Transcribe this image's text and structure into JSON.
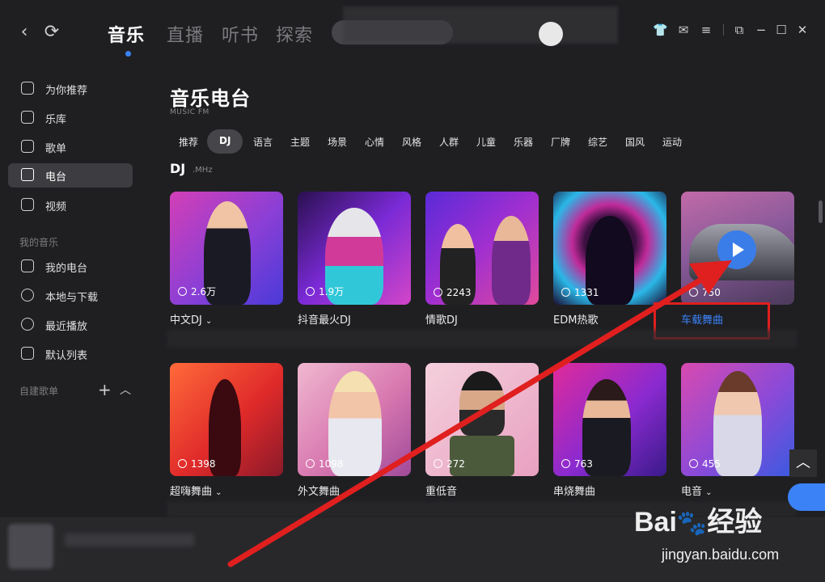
{
  "top": {
    "tabs": [
      "音乐",
      "直播",
      "听书",
      "探索"
    ],
    "active_tab": "音乐"
  },
  "sidebar": {
    "items": [
      {
        "label": "为你推荐",
        "icon": "star-icon"
      },
      {
        "label": "乐库",
        "icon": "music-note-icon"
      },
      {
        "label": "歌单",
        "icon": "playlist-icon"
      },
      {
        "label": "电台",
        "icon": "radio-icon",
        "active": true
      },
      {
        "label": "视频",
        "icon": "video-icon"
      }
    ],
    "my_music_title": "我的音乐",
    "my_items": [
      {
        "label": "我的电台",
        "icon": "radio-icon"
      },
      {
        "label": "本地与下载",
        "icon": "download-icon"
      },
      {
        "label": "最近播放",
        "icon": "clock-icon"
      },
      {
        "label": "默认列表",
        "icon": "list-icon"
      }
    ],
    "custom_title": "自建歌单"
  },
  "page": {
    "title": "音乐电台",
    "subtitle": "MUSIC FM",
    "categories": [
      "推荐",
      "DJ",
      "语言",
      "主题",
      "场景",
      "心情",
      "风格",
      "人群",
      "儿童",
      "乐器",
      "厂牌",
      "综艺",
      "国风",
      "运动"
    ],
    "active_category": "DJ",
    "section_title": "DJ",
    "section_sub": ".MHz"
  },
  "cards": [
    {
      "title": "中文DJ",
      "count": "2.6万",
      "dropdown": true
    },
    {
      "title": "抖音最火DJ",
      "count": "1.9万"
    },
    {
      "title": "情歌DJ",
      "count": "2243"
    },
    {
      "title": "EDM热歌",
      "count": "1331"
    },
    {
      "title": "车载舞曲",
      "count": "750",
      "highlighted": true
    },
    {
      "title": "超嗨舞曲",
      "count": "1398",
      "dropdown": true
    },
    {
      "title": "外文舞曲",
      "count": "1098"
    },
    {
      "title": "重低音",
      "count": "272"
    },
    {
      "title": "串烧舞曲",
      "count": "763"
    },
    {
      "title": "电音",
      "count": "455",
      "dropdown": true
    }
  ],
  "watermark": {
    "brand": "Bai",
    "brand2": "经验",
    "url": "jingyan.baidu.com"
  },
  "colors": {
    "accent": "#3b82f6",
    "annotation": "#e01f1f",
    "background": "#1f1f22"
  }
}
